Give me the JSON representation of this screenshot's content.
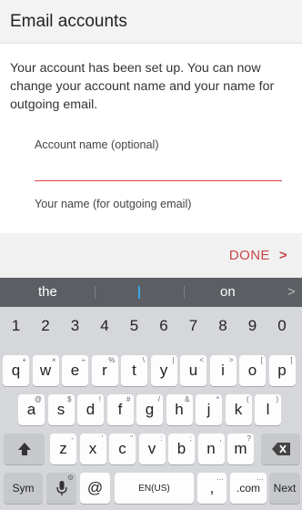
{
  "header": {
    "title": "Email accounts"
  },
  "message": "Your account has been set up. You can now change your account name and your name for outgoing email.",
  "form": {
    "account_name_label": "Account name (optional)",
    "your_name_label": "Your name (for outgoing email)"
  },
  "done_button": {
    "label": "DONE",
    "chevron": ">"
  },
  "keyboard": {
    "suggestions": [
      "the",
      "",
      "on"
    ],
    "suggestion_more": ">",
    "numbers": [
      "1",
      "2",
      "3",
      "4",
      "5",
      "6",
      "7",
      "8",
      "9",
      "0"
    ],
    "row1": [
      {
        "k": "q",
        "s": "+"
      },
      {
        "k": "w",
        "s": "×"
      },
      {
        "k": "e",
        "s": "÷"
      },
      {
        "k": "r",
        "s": "%"
      },
      {
        "k": "t",
        "s": "\\"
      },
      {
        "k": "y",
        "s": "|"
      },
      {
        "k": "u",
        "s": "<"
      },
      {
        "k": "i",
        "s": ">"
      },
      {
        "k": "o",
        "s": "["
      },
      {
        "k": "p",
        "s": "]"
      }
    ],
    "row2": [
      {
        "k": "a",
        "s": "@"
      },
      {
        "k": "s",
        "s": "$"
      },
      {
        "k": "d",
        "s": "!"
      },
      {
        "k": "f",
        "s": "#"
      },
      {
        "k": "g",
        "s": "/"
      },
      {
        "k": "h",
        "s": "&"
      },
      {
        "k": "j",
        "s": "*"
      },
      {
        "k": "k",
        "s": "("
      },
      {
        "k": "l",
        "s": ")"
      }
    ],
    "row3": [
      {
        "k": "z",
        "s": "-"
      },
      {
        "k": "x",
        "s": "'"
      },
      {
        "k": "c",
        "s": "\""
      },
      {
        "k": "v",
        "s": ":"
      },
      {
        "k": "b",
        "s": ";"
      },
      {
        "k": "n",
        "s": ","
      },
      {
        "k": "m",
        "s": "?"
      }
    ],
    "shift_icon": "shift-icon",
    "backspace_icon": "backspace-icon",
    "sym": "Sym",
    "mic_icon": "mic-icon",
    "at": "@",
    "lang": "EN(US)",
    "comma": ",",
    "dotcom": ".com",
    "next": "Next"
  },
  "colors": {
    "accent": "#c8474a",
    "keyboard_bg": "#d6d7db",
    "suggestion_bg": "#5b5f63"
  }
}
